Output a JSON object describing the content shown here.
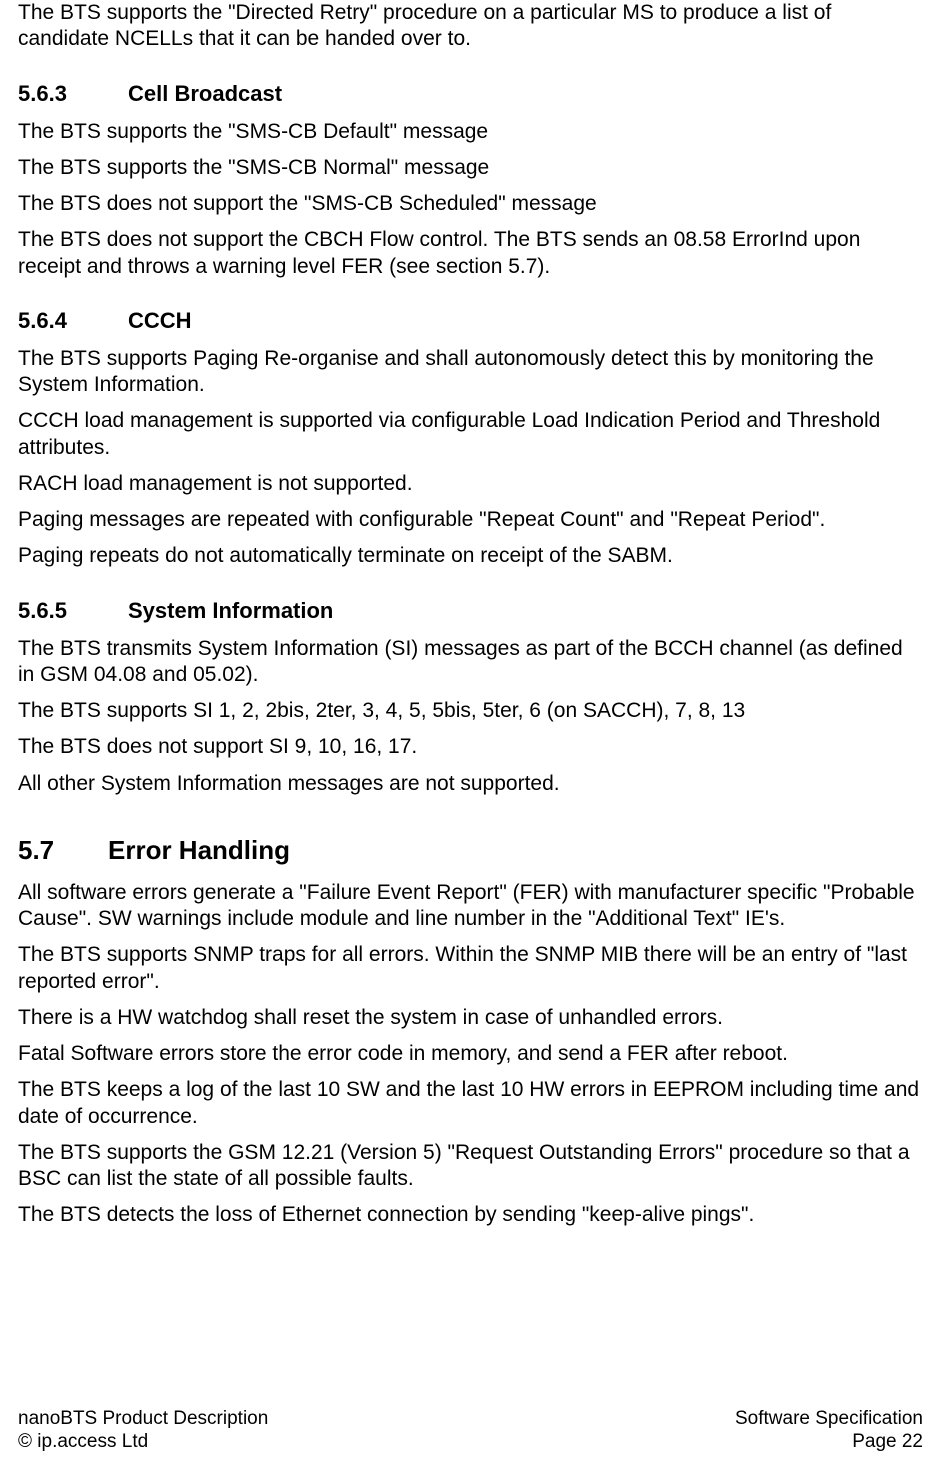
{
  "intro": {
    "p1": "The BTS supports the \"Directed Retry\" procedure on a particular MS to produce a list of candidate NCELLs that it can be handed over to."
  },
  "sec563": {
    "num": "5.6.3",
    "title": "Cell Broadcast",
    "p1": "The BTS supports the \"SMS-CB Default\" message",
    "p2": "The BTS supports the \"SMS-CB Normal\" message",
    "p3": "The BTS does not support the \"SMS-CB Scheduled\" message",
    "p4": "The BTS does not support the CBCH Flow control. The BTS sends an 08.58 ErrorInd upon receipt and throws a warning level FER (see section 5.7)."
  },
  "sec564": {
    "num": "5.6.4",
    "title": "CCCH",
    "p1": "The BTS supports Paging Re-organise and shall autonomously detect this by monitoring the System Information.",
    "p2": "CCCH load management is supported via configurable Load Indication Period and Threshold attributes.",
    "p3": "RACH load management is not supported.",
    "p4": "Paging messages are repeated with configurable \"Repeat Count\" and \"Repeat Period\".",
    "p5": "Paging repeats do not automatically terminate on receipt of the SABM."
  },
  "sec565": {
    "num": "5.6.5",
    "title": "System Information",
    "p1": "The BTS transmits System Information (SI) messages as part of the BCCH channel (as defined in GSM 04.08 and 05.02).",
    "p2": "The BTS supports SI 1, 2, 2bis, 2ter, 3, 4, 5, 5bis, 5ter, 6 (on SACCH), 7, 8, 13",
    "p3": "The BTS does not support SI 9, 10, 16, 17.",
    "p4": "All other System Information messages are not supported."
  },
  "sec57": {
    "num": "5.7",
    "title": "Error Handling",
    "p1": "All software errors generate a \"Failure Event Report\" (FER) with manufacturer specific \"Probable Cause\". SW warnings include module and line number in the \"Additional Text\" IE's.",
    "p2": "The BTS supports SNMP traps for all errors. Within the SNMP MIB there will be an entry of \"last reported error\".",
    "p3": "There is a HW watchdog shall reset the system in case of unhandled errors.",
    "p4": "Fatal Software errors store the error code in memory, and send a FER after reboot.",
    "p5": "The BTS keeps a log of the last 10 SW and the last 10 HW errors in EEPROM including time and date of occurrence.",
    "p6": "The BTS supports the GSM 12.21 (Version 5) \"Request Outstanding Errors\" procedure so that a BSC can list the state of all possible faults.",
    "p7": "The BTS detects the loss of Ethernet connection by sending \"keep-alive pings\"."
  },
  "footer": {
    "left1": "nanoBTS Product Description",
    "left2": "© ip.access Ltd",
    "right1": "Software Specification",
    "right2": "Page 22"
  }
}
